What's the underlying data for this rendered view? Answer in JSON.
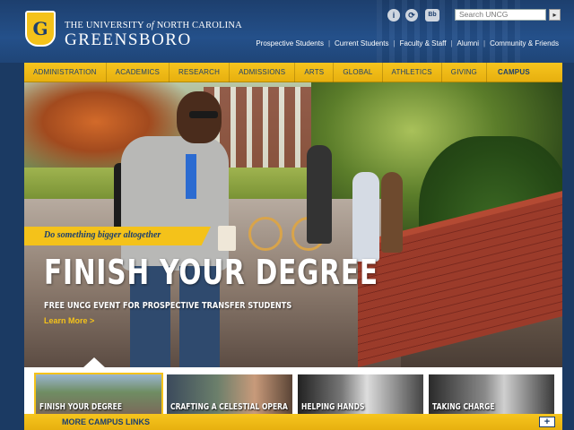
{
  "header": {
    "logo_initial": "G",
    "name_line_prefix": "THE UNIVERSITY",
    "name_line_of": "of",
    "name_line_suffix": "NORTH CAROLINA",
    "name_main": "GREENSBORO",
    "icons": [
      "info-icon",
      "share-icon",
      "blackboard-icon"
    ],
    "icon_glyphs": [
      "i",
      "⟳",
      "Bb"
    ],
    "search_placeholder": "Search UNCG",
    "search_go": "▸",
    "audience_links": [
      "Prospective Students",
      "Current Students",
      "Faculty & Staff",
      "Alumni",
      "Community & Friends"
    ]
  },
  "nav": {
    "items": [
      "ADMINISTRATION",
      "ACADEMICS",
      "RESEARCH",
      "ADMISSIONS",
      "ARTS",
      "GLOBAL",
      "ATHLETICS",
      "GIVING"
    ],
    "campus_links": "CAMPUS LINKS"
  },
  "hero": {
    "tagline": "Do something bigger altogether",
    "headline": "FINISH YOUR DEGREE",
    "subhead": "FREE UNCG EVENT FOR PROSPECTIVE TRANSFER STUDENTS",
    "learn_more": "Learn More >"
  },
  "thumbnails": [
    {
      "label": "FINISH YOUR DEGREE",
      "active": true
    },
    {
      "label": "CRAFTING A CELESTIAL OPERA",
      "active": false
    },
    {
      "label": "HELPING HANDS",
      "active": false
    },
    {
      "label": "TAKING CHARGE",
      "active": false
    }
  ],
  "footer_bar": {
    "label": "MORE CAMPUS LINKS",
    "toggle": "+"
  },
  "colors": {
    "navy": "#1d3f6e",
    "gold": "#f4c21a"
  }
}
